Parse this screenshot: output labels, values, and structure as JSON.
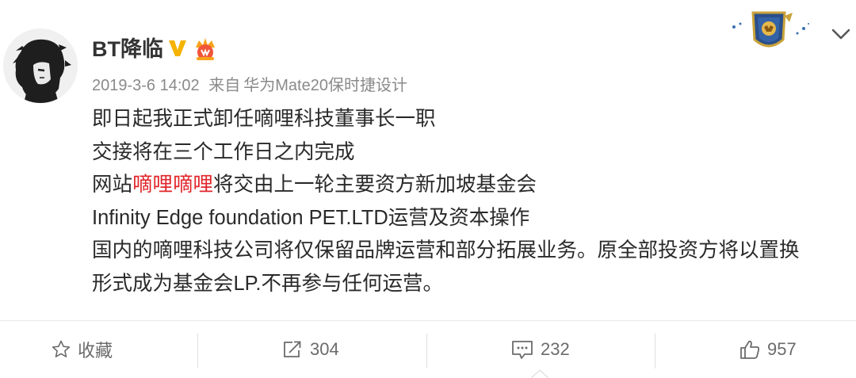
{
  "post": {
    "username": "BT降临",
    "timestamp": "2019-3-6 14:02",
    "source_prefix": "来自",
    "source": "华为Mate20保时捷设计",
    "content": {
      "line1": "即日起我正式卸任嘀哩科技董事长一职",
      "line2": "交接将在三个工作日之内完成",
      "line3_before": "网站",
      "line3_link": "嘀哩嘀哩",
      "line3_after": "将交由上一轮主要资方新加坡基金会",
      "line4": "Infinity Edge foundation PET.LTD运营及资本操作",
      "line5": "国内的嘀哩科技公司将仅保留品牌运营和部分拓展业务。原全部投资方将以置换",
      "line6": "形式成为基金会LP.不再参与任何运营。"
    }
  },
  "actions": {
    "favorite_label": "收藏",
    "repost_count": "304",
    "comment_count": "232",
    "like_count": "957"
  },
  "icons": {
    "verified": "v-verified-badge",
    "vip": "crown-icon",
    "pendant": "shield-lion-icon",
    "menu": "chevron-down-icon",
    "favorite": "star-icon",
    "repost": "repost-icon",
    "comment": "comment-icon",
    "like": "thumbs-up-icon"
  },
  "colors": {
    "highlight": "#e0262b",
    "verified_badge": "#f5b300",
    "meta_text": "#8a8a8a"
  }
}
